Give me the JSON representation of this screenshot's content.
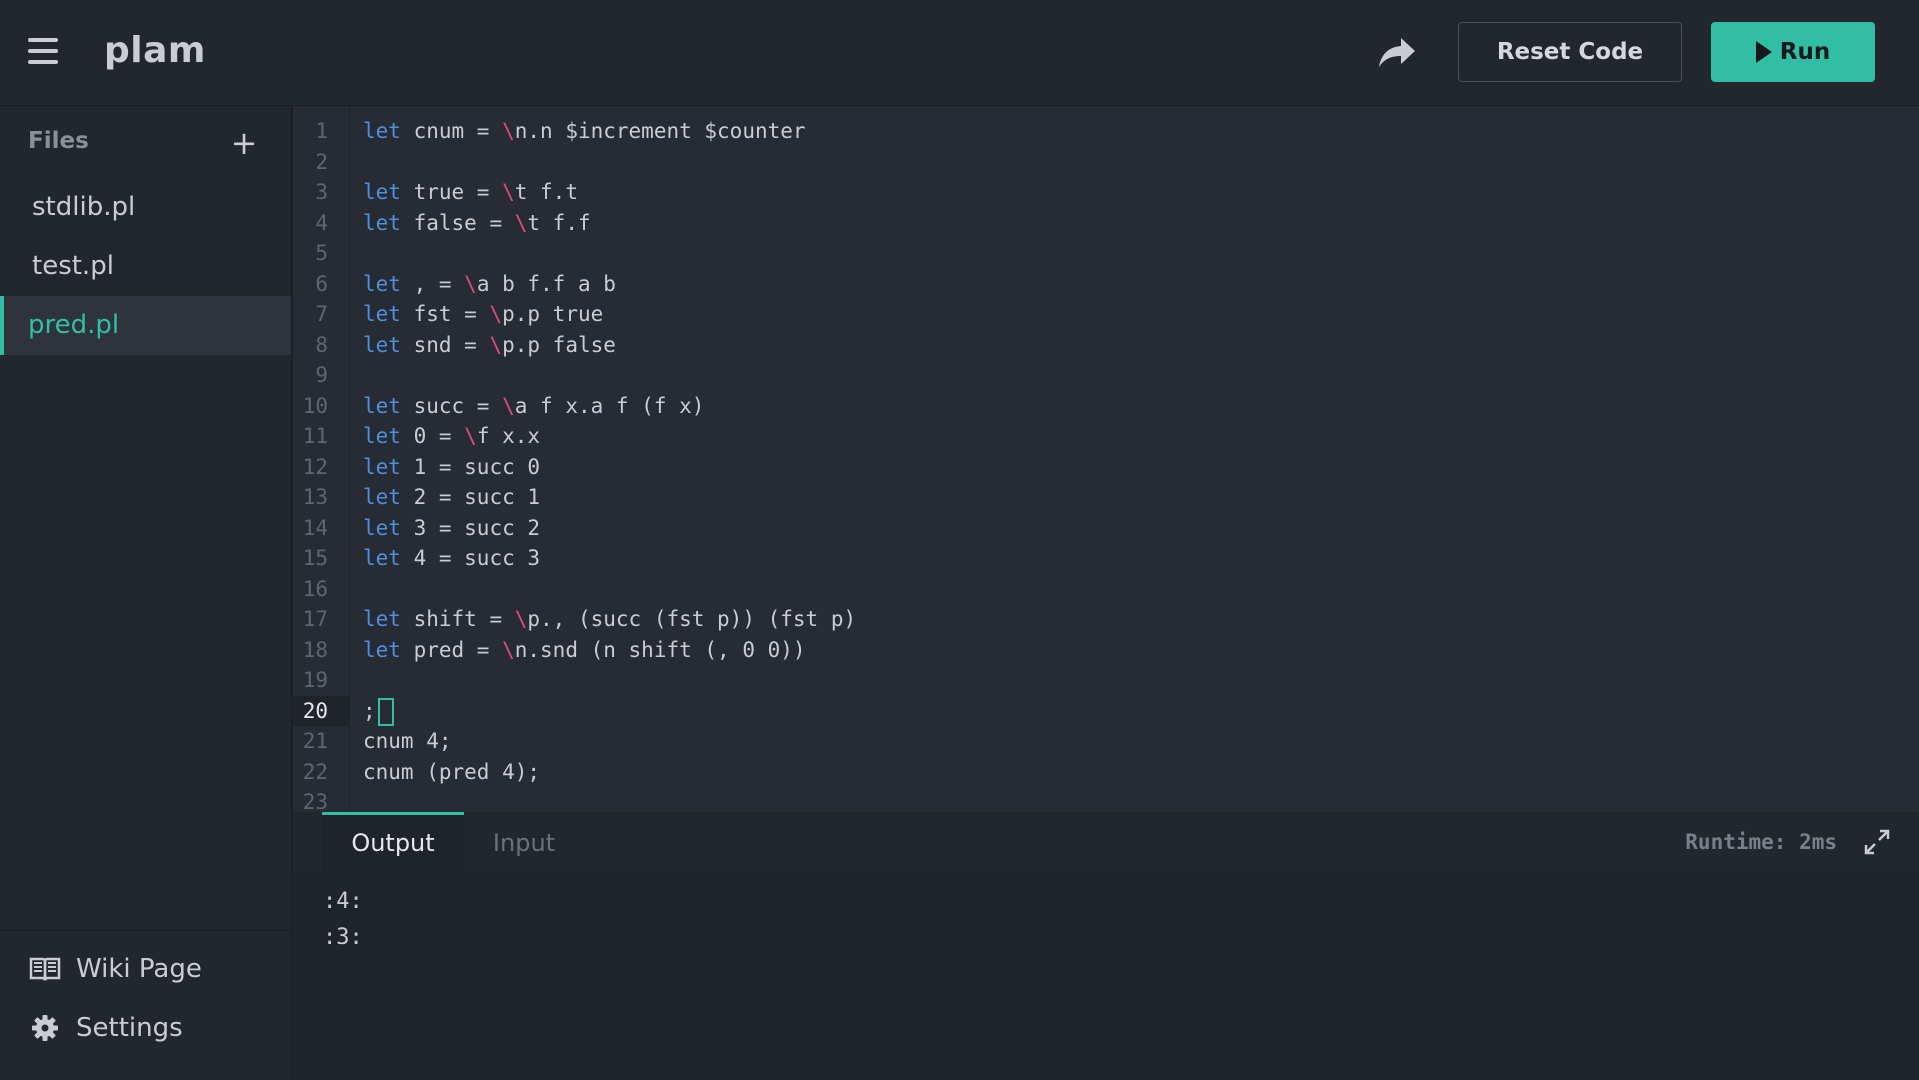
{
  "app": {
    "title": "plam"
  },
  "header": {
    "reset_label": "Reset Code",
    "run_label": "Run",
    "icons": {
      "menu": "hamburger-menu-icon",
      "share": "share-arrow-icon",
      "run": "play-icon"
    }
  },
  "sidebar": {
    "files_heading": "Files",
    "add_label": "+",
    "files": [
      {
        "name": "stdlib.pl",
        "active": false
      },
      {
        "name": "test.pl",
        "active": false
      },
      {
        "name": "pred.pl",
        "active": true
      }
    ],
    "footer": [
      {
        "label": "Wiki Page",
        "icon": "book-icon"
      },
      {
        "label": "Settings",
        "icon": "gear-icon"
      }
    ]
  },
  "editor": {
    "current_line": 20,
    "lines": [
      "let cnum = \\n.n $increment $counter",
      "",
      "let true = \\t f.t",
      "let false = \\t f.f",
      "",
      "let , = \\a b f.f a b",
      "let fst = \\p.p true",
      "let snd = \\p.p false",
      "",
      "let succ = \\a f x.a f (f x)",
      "let 0 = \\f x.x",
      "let 1 = succ 0",
      "let 2 = succ 1",
      "let 3 = succ 2",
      "let 4 = succ 3",
      "",
      "let shift = \\p., (succ (fst p)) (fst p)",
      "let pred = \\n.snd (n shift (, 0 0))",
      "",
      ";",
      "cnum 4;",
      "cnum (pred 4);",
      ""
    ]
  },
  "panel": {
    "tabs": [
      {
        "label": "Output",
        "active": true
      },
      {
        "label": "Input",
        "active": false
      }
    ],
    "runtime": "Runtime: 2ms",
    "output": [
      ":4:",
      ":3:"
    ]
  },
  "colors": {
    "accent": "#31bea5",
    "keyword": "#4f8fe0",
    "lambda": "#e04a7c",
    "background": "#1f232a"
  }
}
